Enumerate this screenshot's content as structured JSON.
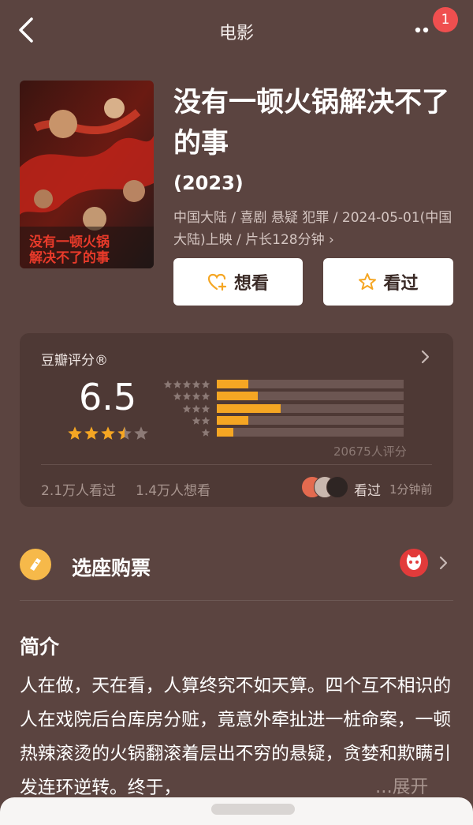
{
  "nav": {
    "title": "电影",
    "badge_count": "1"
  },
  "movie": {
    "title": "没有一顿火锅解决不了的事",
    "year": "(2023)",
    "meta": "中国大陆 / 喜剧 悬疑 犯罪 / 2024-05-01(中国大陆)上映 / 片长128分钟 ›",
    "want_label": "想看",
    "seen_label": "看过"
  },
  "rating": {
    "header": "豆瓣评分®",
    "score": "6.5",
    "score_stars": 3.5,
    "distribution": [
      {
        "stars": 5,
        "percent": 17
      },
      {
        "stars": 4,
        "percent": 22
      },
      {
        "stars": 3,
        "percent": 34
      },
      {
        "stars": 2,
        "percent": 17
      },
      {
        "stars": 1,
        "percent": 9
      }
    ],
    "count": "20675人评分",
    "watched": "2.1万人看过",
    "wish": "1.4万人想看",
    "recent_label": "看过",
    "recent_time": "1分钟前"
  },
  "ticket": {
    "label": "选座购票"
  },
  "intro": {
    "title": "简介",
    "text": "人在做，天在看，人算终究不如天算。四个互不相识的人在戏院后台库房分赃，竟意外牵扯进一桩命案，一顿热辣滚烫的火锅翻滚着层出不穷的悬疑，贪婪和欺瞒引发连环逆转。终于，",
    "expand": "...展开"
  },
  "colors": {
    "accent": "#f5a623",
    "bg": "#5b4440",
    "card": "#4e3935"
  }
}
